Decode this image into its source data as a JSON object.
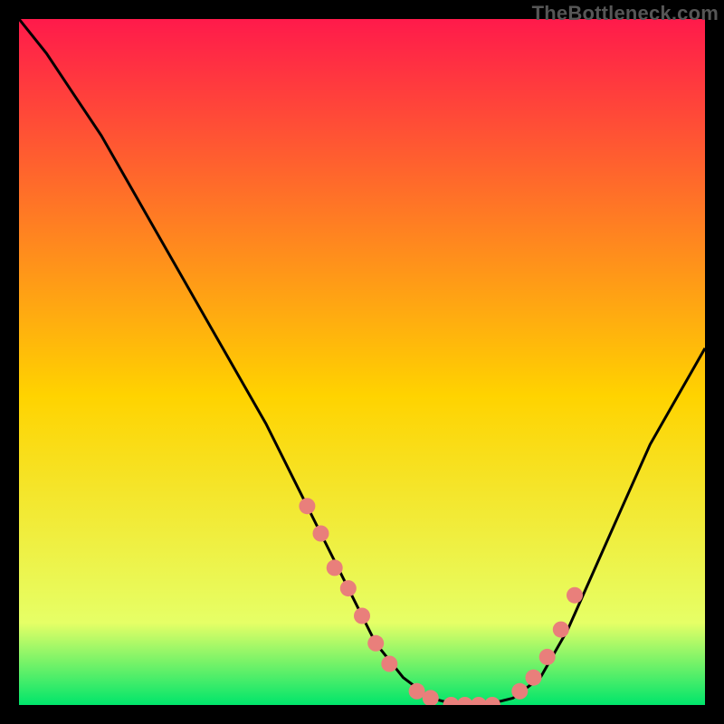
{
  "watermark": "TheBottleneck.com",
  "colors": {
    "bg_black": "#000000",
    "grad_top": "#ff1a4b",
    "grad_mid": "#ffd300",
    "grad_low": "#e6ff66",
    "grad_bottom": "#00e56b",
    "curve": "#000000",
    "marker": "#e97f7b"
  },
  "chart_data": {
    "type": "line",
    "title": "",
    "xlabel": "",
    "ylabel": "",
    "xlim": [
      0,
      100
    ],
    "ylim": [
      0,
      100
    ],
    "grid": false,
    "legend": false,
    "series": [
      {
        "name": "bottleneck-curve",
        "x": [
          0,
          4,
          8,
          12,
          16,
          20,
          24,
          28,
          32,
          36,
          40,
          44,
          48,
          52,
          56,
          60,
          64,
          68,
          72,
          76,
          80,
          84,
          88,
          92,
          96,
          100
        ],
        "y": [
          100,
          95,
          89,
          83,
          76,
          69,
          62,
          55,
          48,
          41,
          33,
          25,
          17,
          9,
          4,
          1,
          0,
          0,
          1,
          4,
          11,
          20,
          29,
          38,
          45,
          52
        ]
      }
    ],
    "markers": {
      "name": "highlighted-points",
      "x": [
        42,
        44,
        46,
        48,
        50,
        52,
        54,
        58,
        60,
        63,
        65,
        67,
        69,
        73,
        75,
        77,
        79,
        81
      ],
      "y": [
        29,
        25,
        20,
        17,
        13,
        9,
        6,
        2,
        1,
        0,
        0,
        0,
        0,
        2,
        4,
        7,
        11,
        16
      ]
    }
  }
}
